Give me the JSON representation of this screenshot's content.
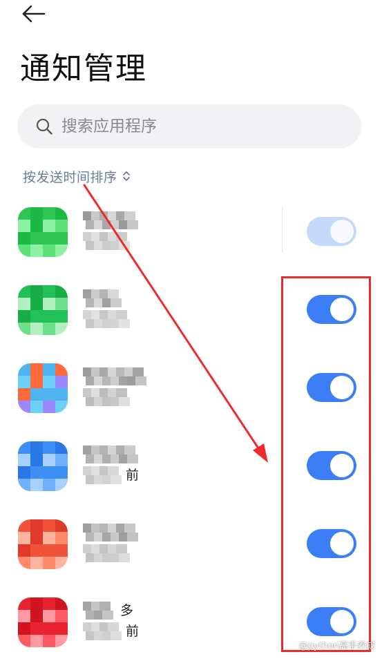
{
  "header": {
    "title": "通知管理"
  },
  "search": {
    "placeholder": "搜索应用程序"
  },
  "sort": {
    "label": "按发送时间排序"
  },
  "apps": [
    {
      "name_mosaic": [
        "#9a9a9a",
        "#c8c8c8",
        "#b0b0b0",
        "#d8d8d8",
        "#a8a8a8",
        "#cfcfcf"
      ],
      "sub_mosaic": [
        "#d0d0d0",
        "#e0e0e0",
        "#c4c4c4",
        "#dcdcdc",
        "#cccccc"
      ],
      "icon_colors": [
        "#2fc655",
        "#5ee078",
        "#1db946",
        "#8ef0a2"
      ],
      "enabled": true,
      "dimmed": true,
      "name_char": "",
      "sub_char": ""
    },
    {
      "name_mosaic": [
        "#a0a0a0",
        "#cccccc",
        "#b4b4b4",
        "#d8d8d8"
      ],
      "sub_mosaic": [
        "#d4d4d4",
        "#e2e2e2",
        "#c8c8c8",
        "#dadada",
        "#d0d0d0"
      ],
      "icon_colors": [
        "#22c158",
        "#6ee08c",
        "#19ad48",
        "#b2f0c2"
      ],
      "enabled": true,
      "dimmed": false,
      "name_char": "",
      "sub_char": ""
    },
    {
      "name_mosaic": [
        "#9c9c9c",
        "#c4c4c4",
        "#aaaaaa",
        "#d6d6d6",
        "#b8b8b8",
        "#cecece",
        "#a4a4a4"
      ],
      "sub_mosaic": [
        "#c8c8c8",
        "#dedede",
        "#bcbcbc",
        "#d2d2d2",
        "#c2c2c2"
      ],
      "icon_colors": [
        "#4fb4f0",
        "#9b87ff",
        "#ff6a3d",
        "#6fd0f5"
      ],
      "enabled": true,
      "dimmed": false,
      "name_char": "",
      "sub_char": ""
    },
    {
      "name_mosaic": [
        "#a2a2a2",
        "#c6c6c6",
        "#b2b2b2",
        "#d4d4d4",
        "#aeaeae",
        "#cacaca"
      ],
      "sub_mosaic": [
        "#d2d2d2",
        "#e0e0e0",
        "#c6c6c6",
        "#d8d8d8"
      ],
      "icon_colors": [
        "#3d8ff5",
        "#6fb0ff",
        "#2a78e6",
        "#a8d0ff"
      ],
      "enabled": true,
      "dimmed": false,
      "name_char": "",
      "sub_char": "前"
    },
    {
      "name_mosaic": [
        "#9e9e9e",
        "#c2c2c2",
        "#b6b6b6",
        "#d2d2d2",
        "#a6a6a6",
        "#c8c8c8"
      ],
      "sub_mosaic": [
        "#cecece",
        "#dcdcdc",
        "#c4c4c4",
        "#d6d6d6",
        "#cacaca"
      ],
      "icon_colors": [
        "#f0533a",
        "#ff8a6a",
        "#e03a2a",
        "#ffb4a0"
      ],
      "enabled": true,
      "dimmed": false,
      "name_char": "",
      "sub_char": ""
    },
    {
      "name_mosaic": [
        "#a4a4a4",
        "#c4c4c4",
        "#b0b0b0"
      ],
      "sub_mosaic": [
        "#d0d0d0",
        "#dedede",
        "#c6c6c6",
        "#d6d6d6"
      ],
      "icon_colors": [
        "#e8222e",
        "#ff5a64",
        "#d01420",
        "#ff9aa2"
      ],
      "enabled": true,
      "dimmed": false,
      "name_char": "多",
      "sub_char": "前"
    }
  ],
  "watermark": {
    "text": "@python高手养成"
  },
  "colors": {
    "accent": "#3b7ef5",
    "annotation": "#ee2a2a"
  }
}
